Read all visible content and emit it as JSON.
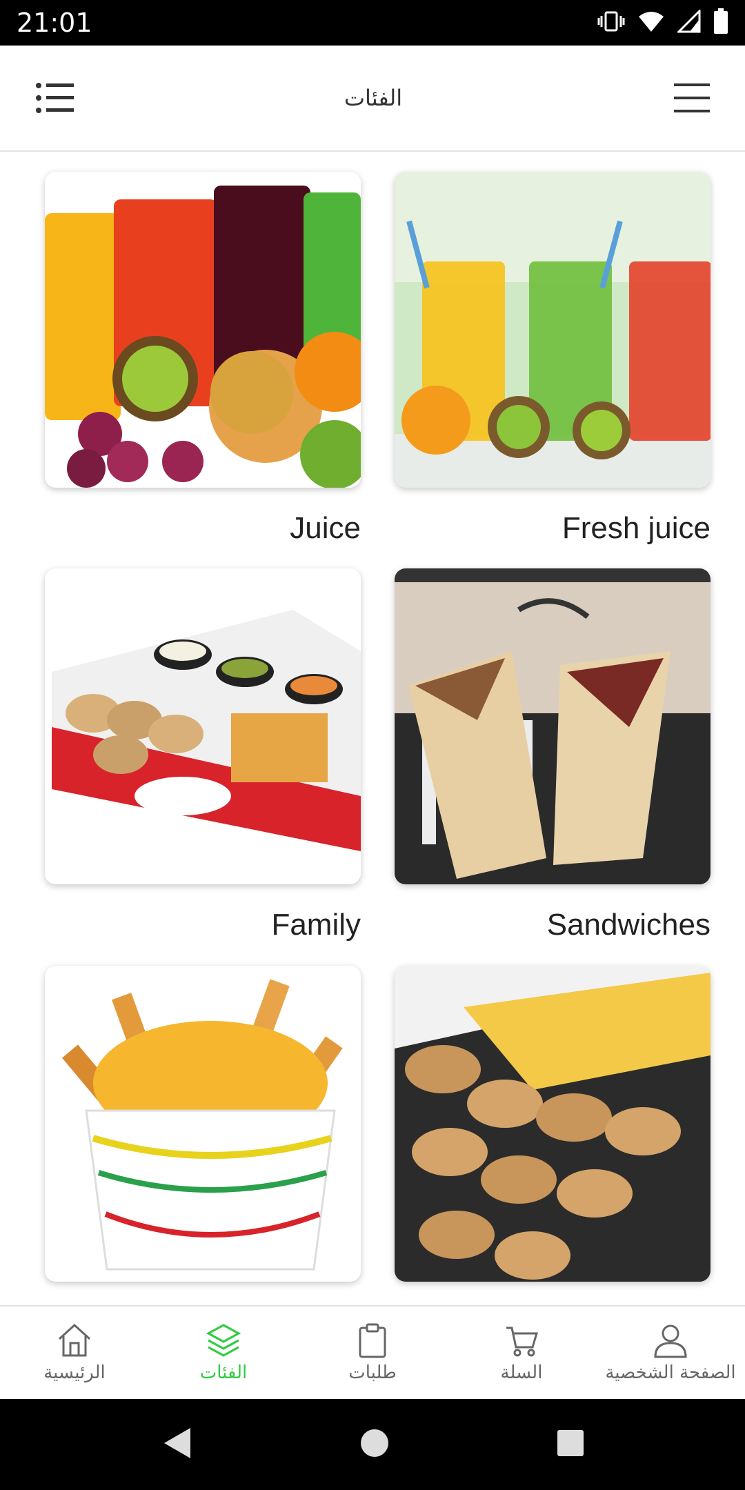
{
  "status_bar": {
    "time": "21:01"
  },
  "app_bar": {
    "title": "الفئات"
  },
  "categories": [
    {
      "label": "Fresh juice"
    },
    {
      "label": "Juice"
    },
    {
      "label": "Sandwiches"
    },
    {
      "label": "Family"
    },
    {
      "label": ""
    },
    {
      "label": ""
    }
  ],
  "bottom_nav": {
    "items": [
      {
        "label": "الرئيسية",
        "icon": "home-icon"
      },
      {
        "label": "الفئات",
        "icon": "layers-icon",
        "active": true
      },
      {
        "label": "طلبات",
        "icon": "clipboard-icon"
      },
      {
        "label": "السلة",
        "icon": "cart-icon"
      },
      {
        "label": "الصفحة الشخصية",
        "icon": "user-icon"
      }
    ]
  },
  "colors": {
    "accent": "#2ecc40",
    "status_bar": "#000000",
    "text": "#222222"
  }
}
